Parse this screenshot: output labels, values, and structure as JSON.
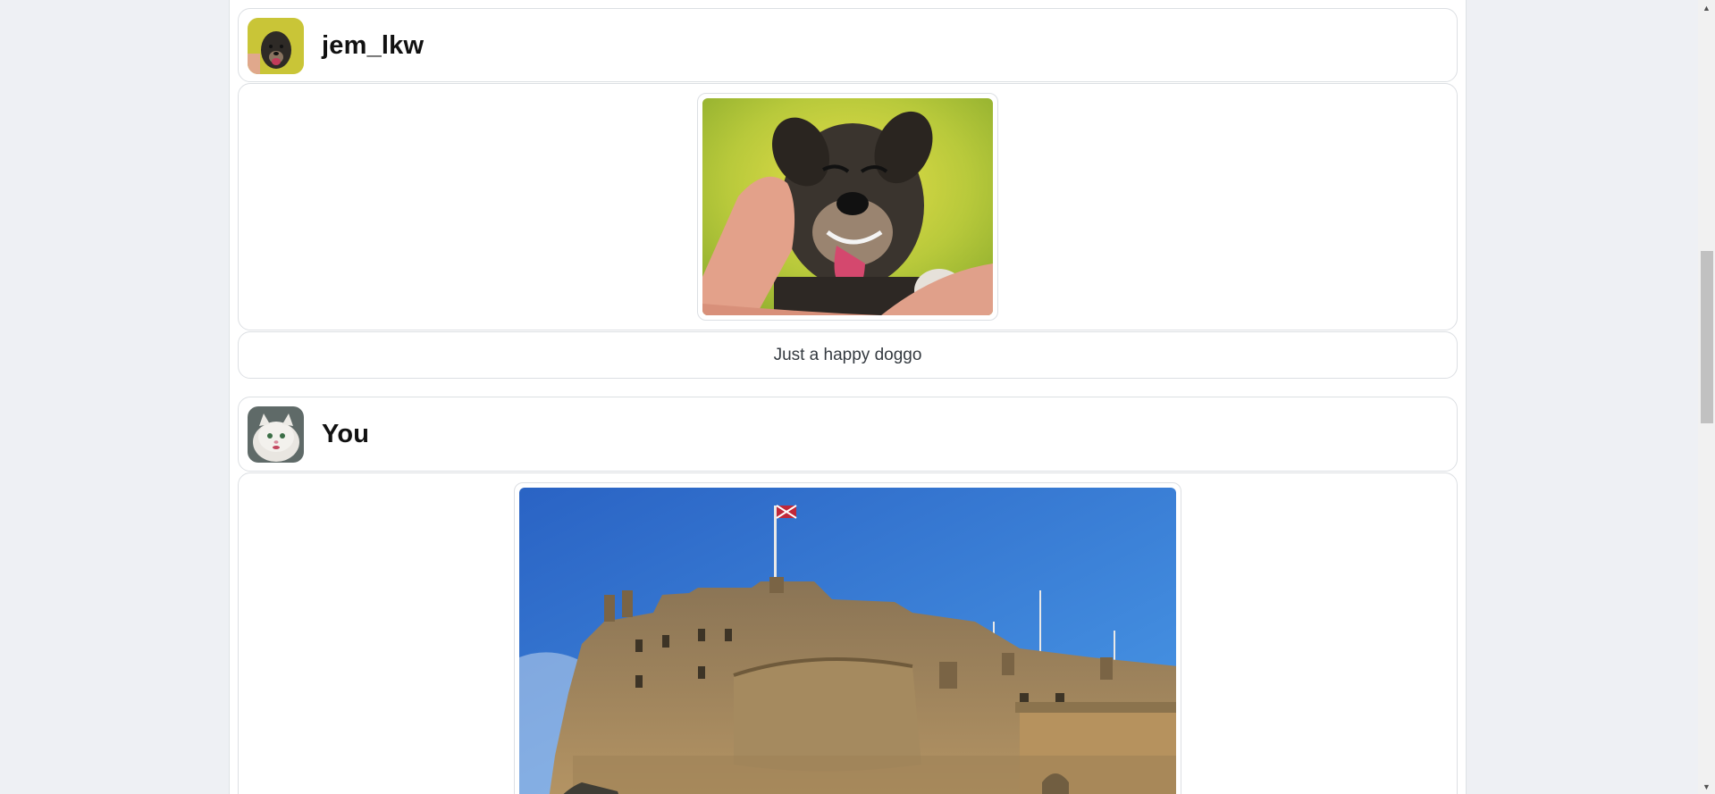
{
  "posts": [
    {
      "username": "jem_lkw",
      "avatar_icon": "dog-avatar-icon",
      "image_subject": "happy-dog-photo",
      "caption": "Just a happy doggo"
    },
    {
      "username": "You",
      "avatar_icon": "cat-avatar-icon",
      "image_subject": "castle-photo"
    }
  ],
  "scrollbar": {
    "up_arrow": "▲",
    "down_arrow": "▼"
  },
  "colors": {
    "page_background": "#eef0f4",
    "card_border": "#dcdfe3",
    "sky_blue": "#2f7fd6"
  }
}
